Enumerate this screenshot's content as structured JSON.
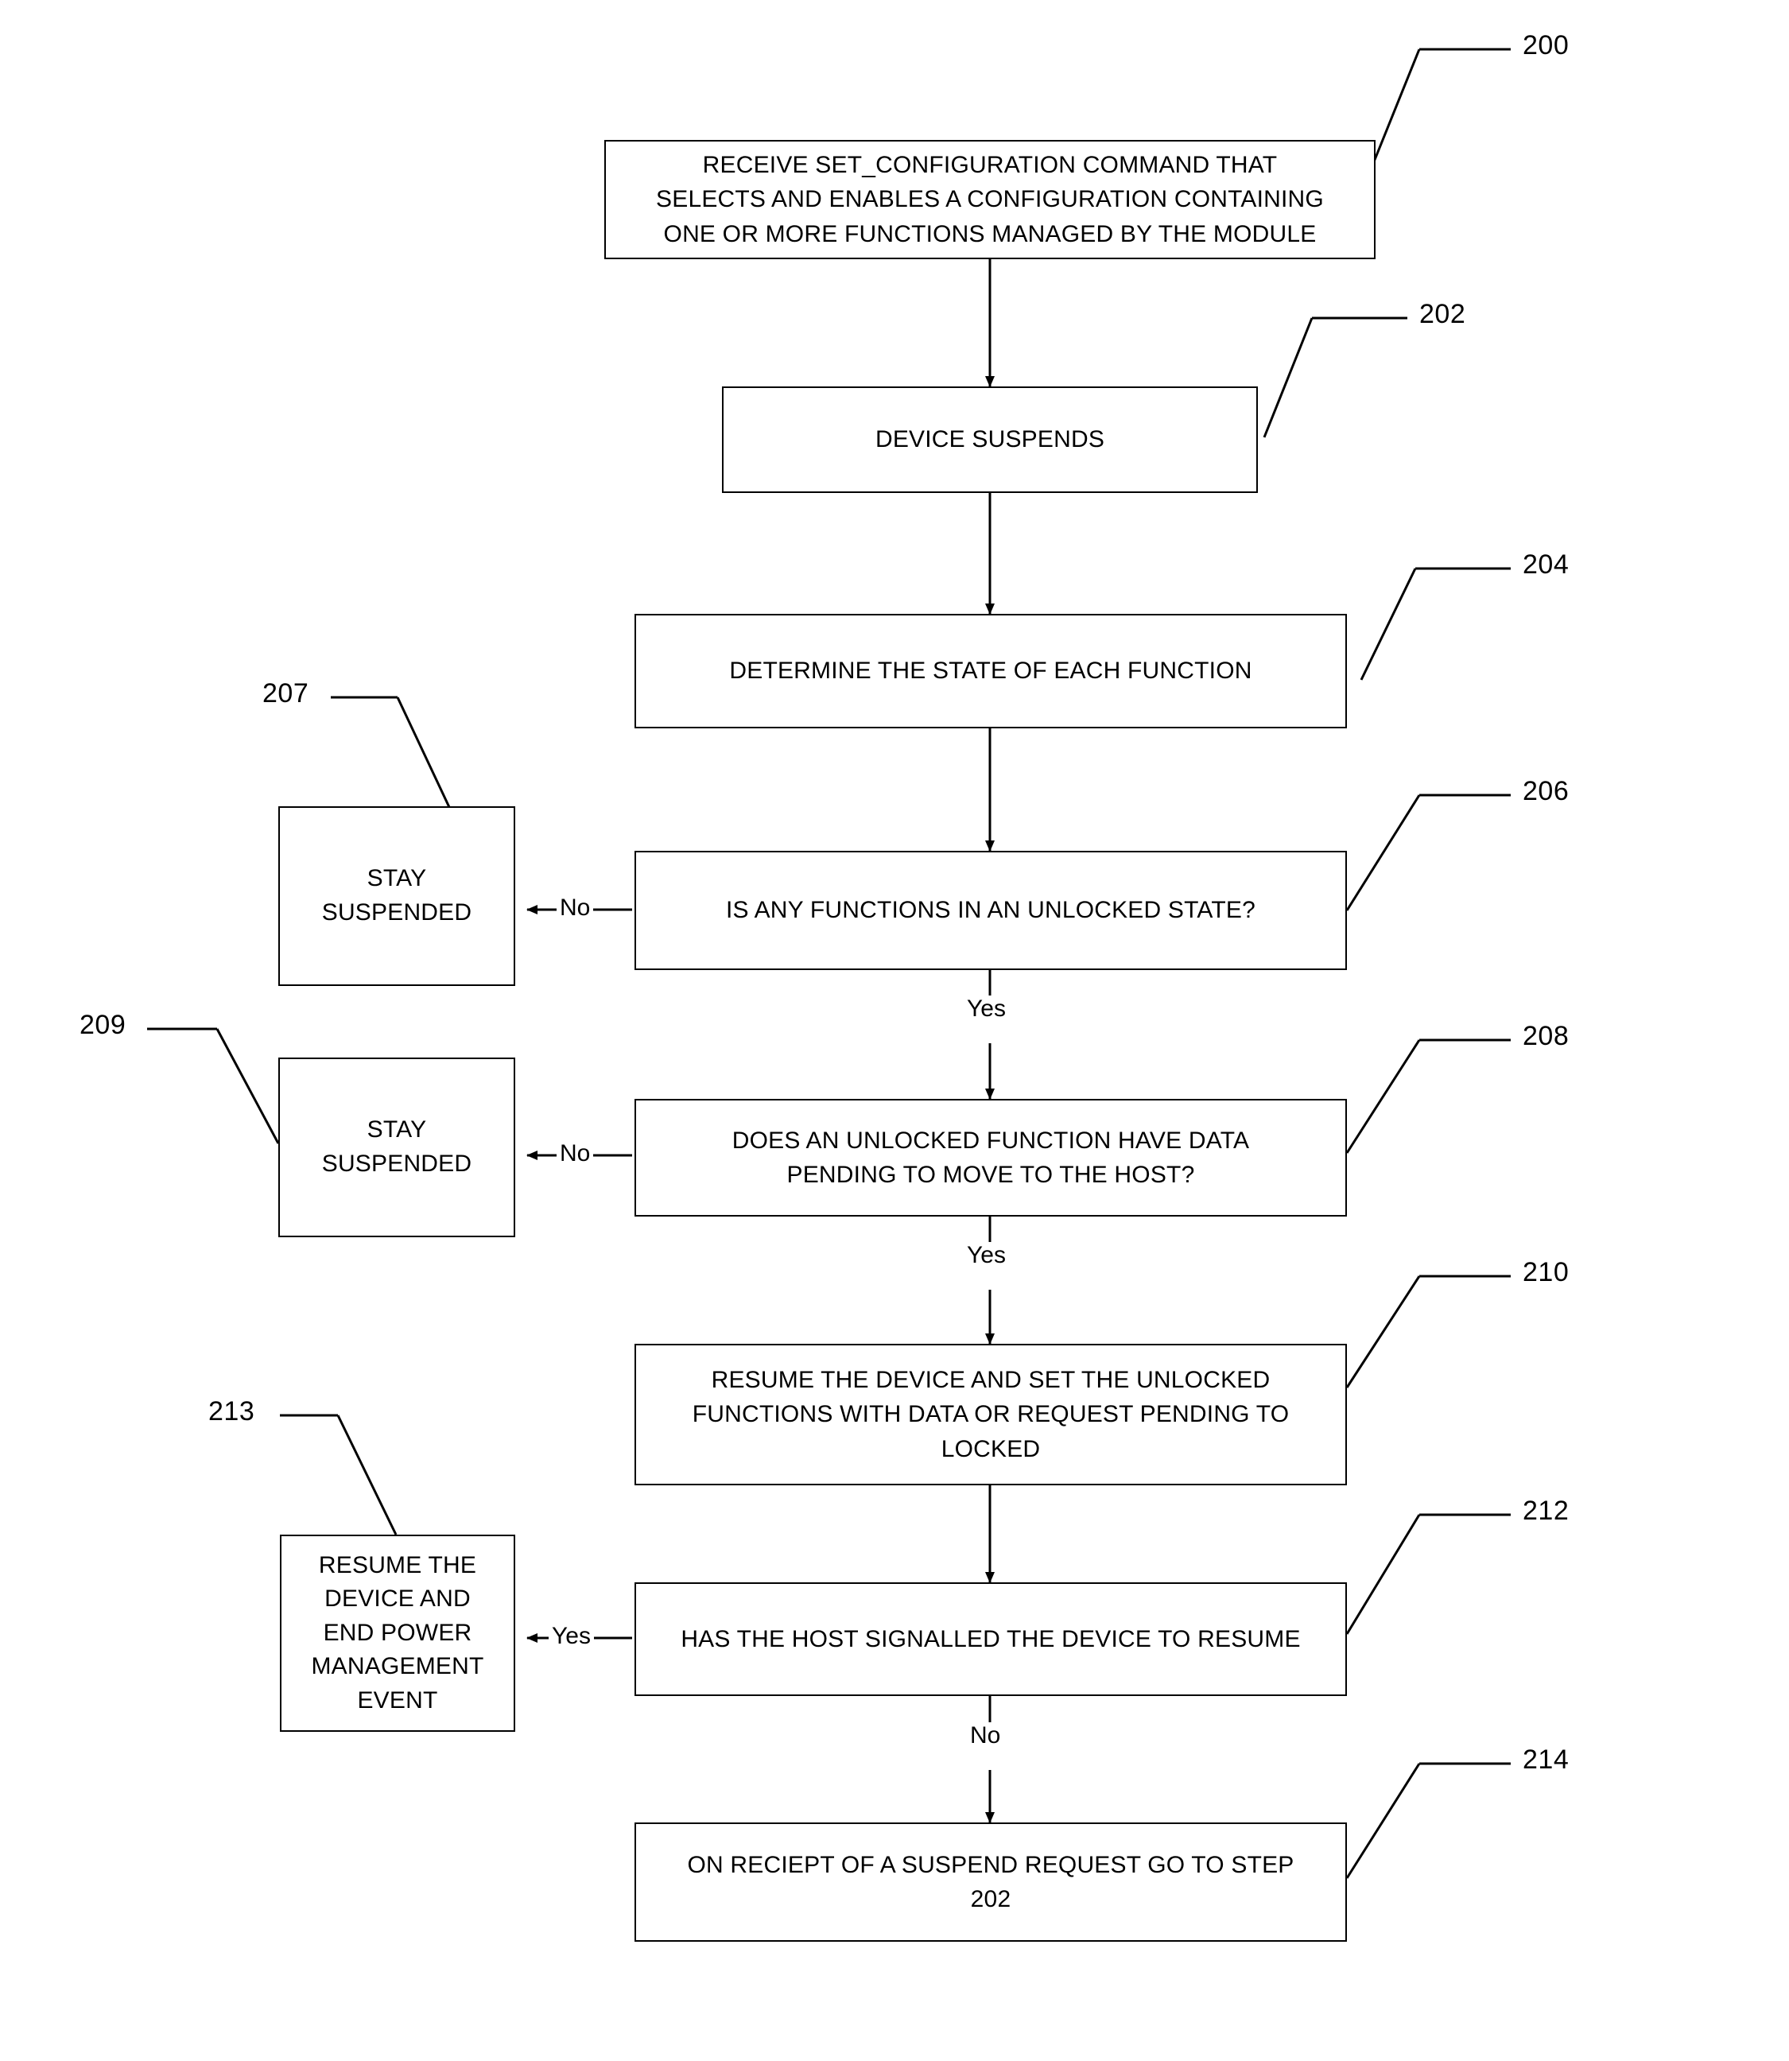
{
  "figure": {
    "type": "patent-flowchart",
    "background": "#ffffff",
    "stroke": "#000000"
  },
  "nodes": [
    {
      "id": "n200",
      "ref": "200",
      "text": "RECEIVE SET_CONFIGURATION COMMAND THAT\nSELECTS AND ENABLES A CONFIGURATION CONTAINING\nONE OR MORE FUNCTIONS MANAGED BY THE MODULE"
    },
    {
      "id": "n202",
      "ref": "202",
      "text": "DEVICE SUSPENDS"
    },
    {
      "id": "n204",
      "ref": "204",
      "text": "DETERMINE THE STATE OF EACH FUNCTION"
    },
    {
      "id": "n206",
      "ref": "206",
      "text": "IS ANY FUNCTIONS IN AN UNLOCKED STATE?"
    },
    {
      "id": "n207",
      "ref": "207",
      "text": "STAY\nSUSPENDED"
    },
    {
      "id": "n208",
      "ref": "208",
      "text": "DOES AN UNLOCKED FUNCTION HAVE DATA\nPENDING TO MOVE TO THE HOST?"
    },
    {
      "id": "n209",
      "ref": "209",
      "text": "STAY\nSUSPENDED"
    },
    {
      "id": "n210",
      "ref": "210",
      "text": "RESUME THE DEVICE AND SET THE UNLOCKED\nFUNCTIONS WITH DATA OR REQUEST PENDING TO\nLOCKED"
    },
    {
      "id": "n212",
      "ref": "212",
      "text": "HAS THE HOST SIGNALLED THE DEVICE TO RESUME"
    },
    {
      "id": "n213",
      "ref": "213",
      "text": "RESUME THE\nDEVICE AND\nEND POWER\nMANAGEMENT\nEVENT"
    },
    {
      "id": "n214",
      "ref": "214",
      "text": "ON RECIEPT OF A SUSPEND REQUEST GO TO STEP\n202"
    }
  ],
  "edge_labels": {
    "e206_no": "No",
    "e206_yes": "Yes",
    "e208_no": "No",
    "e208_yes": "Yes",
    "e212_yes": "Yes",
    "e212_no": "No"
  }
}
